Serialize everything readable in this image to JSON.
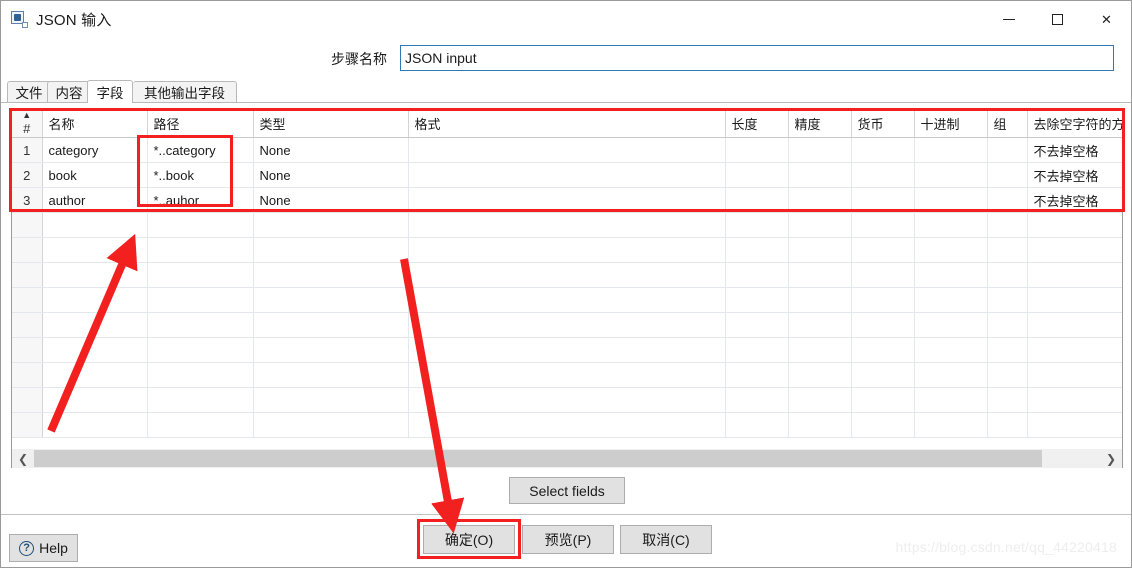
{
  "window": {
    "title": "JSON 输入",
    "icon": "json-input-icon",
    "controls": {
      "minimize": "minimize-icon",
      "maximize": "maximize-icon",
      "close": "close-icon"
    }
  },
  "step": {
    "label": "步骤名称",
    "value": "JSON input",
    "placeholder": ""
  },
  "tabs": [
    {
      "label": "文件",
      "active": false
    },
    {
      "label": "内容",
      "active": false
    },
    {
      "label": "字段",
      "active": true
    },
    {
      "label": "其他输出字段",
      "active": false
    }
  ],
  "grid": {
    "columns": [
      "#",
      "名称",
      "路径",
      "类型",
      "格式",
      "长度",
      "精度",
      "货币",
      "十进制",
      "组",
      "去除空字符的方式"
    ],
    "rows": [
      {
        "index": "1",
        "name": "category",
        "path": "*..category",
        "type": "None",
        "format": "",
        "length": "",
        "precision": "",
        "currency": "",
        "decimal": "",
        "group": "",
        "trim": "不去掉空格"
      },
      {
        "index": "2",
        "name": "book",
        "path": "*..book",
        "type": "None",
        "format": "",
        "length": "",
        "precision": "",
        "currency": "",
        "decimal": "",
        "group": "",
        "trim": "不去掉空格"
      },
      {
        "index": "3",
        "name": "author",
        "path": "*..auhor",
        "type": "None",
        "format": "",
        "length": "",
        "precision": "",
        "currency": "",
        "decimal": "",
        "group": "",
        "trim": "不去掉空格"
      }
    ],
    "empty_row_count": 9,
    "sort_indicator": "▲"
  },
  "scrollbar": {
    "left_arrow": "chevron-left-icon",
    "right_arrow": "chevron-right-icon"
  },
  "buttons": {
    "select_fields": "Select fields",
    "ok": "确定(O)",
    "preview": "预览(P)",
    "cancel": "取消(C)",
    "help": "Help"
  },
  "annotations": {
    "accent_color": "#f32020",
    "highlight_table": true,
    "highlight_path_column": true,
    "highlight_ok_button": true,
    "arrow_count": 2
  },
  "watermark": "https://blog.csdn.net/qq_44220418"
}
